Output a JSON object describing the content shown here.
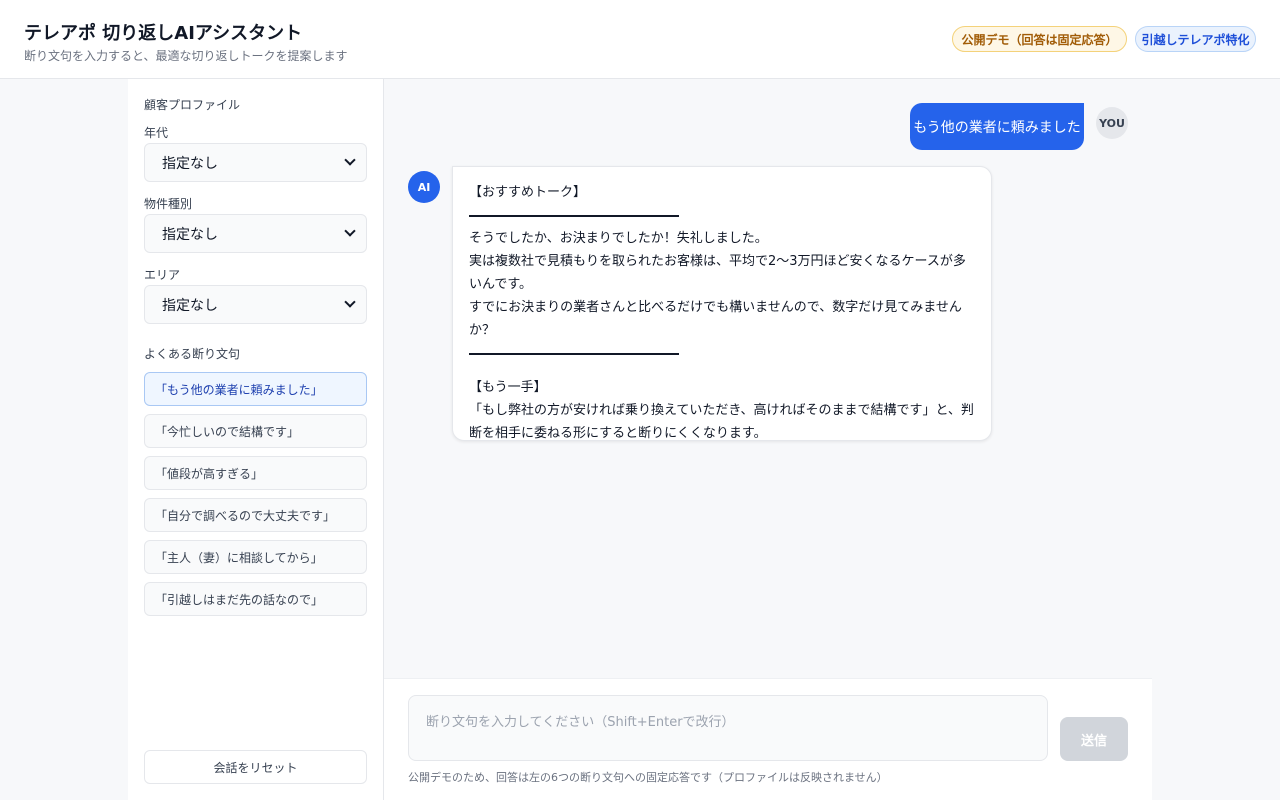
{
  "header": {
    "title": "テレアポ 切り返しAIアシスタント",
    "subtitle": "断り文句を入力すると、最適な切り返しトークを提案します",
    "badge_demo": "公開デモ（回答は固定応答）",
    "badge_spec": "引越しテレアポ特化"
  },
  "sidebar": {
    "profile_title": "顧客プロファイル",
    "fields": [
      {
        "label": "年代",
        "value": "指定なし"
      },
      {
        "label": "物件種別",
        "value": "指定なし"
      },
      {
        "label": "エリア",
        "value": "指定なし"
      }
    ],
    "phrases_title": "よくある断り文句",
    "phrases": [
      "「もう他の業者に頼みました」",
      "「今忙しいので結構です」",
      "「値段が高すぎる」",
      "「自分で調べるので大丈夫です」",
      "「主人（妻）に相談してから」",
      "「引越しはまだ先の話なので」"
    ],
    "reset_label": "会話をリセット"
  },
  "chat": {
    "user_message": "もう他の業者に頼みました",
    "user_avatar": "YOU",
    "ai_avatar": "AI",
    "ai_message": {
      "heading1": "【おすすめトーク】",
      "line1": "そうでしたか、お決まりでしたか！失礼しました。",
      "line2": "実は複数社で見積もりを取られたお客様は、平均で2〜3万円ほど安くなるケースが多いんです。",
      "line3": "すでにお決まりの業者さんと比べるだけでも構いませんので、数字だけ見てみませんか？",
      "heading2": "【もう一手】",
      "line4": "「もし弊社の方が安ければ乗り換えていただき、高ければそのままで結構です」と、判断を相手に委ねる形にすると断りにくくなります。"
    }
  },
  "composer": {
    "placeholder": "断り文句を入力してください（Shift+Enterで改行）",
    "send_label": "送信",
    "note": "公開デモのため、回答は左の6つの断り文句への固定応答です（プロファイルは反映されません）"
  },
  "colors": {
    "accent": "#2563eb",
    "badge_demo_text": "#a15c07",
    "badge_spec_text": "#1d4ed8"
  }
}
